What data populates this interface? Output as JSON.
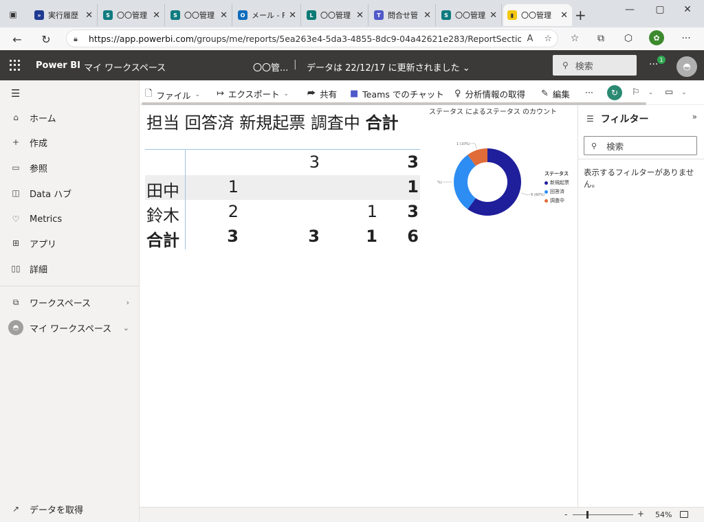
{
  "browser": {
    "tabs": [
      {
        "title": "実行履歴",
        "fav_color": "#1f3a93",
        "fav_glyph": "»"
      },
      {
        "title": "〇〇管理",
        "fav_color": "#0f7b7f",
        "fav_glyph": "S"
      },
      {
        "title": "〇〇管理",
        "fav_color": "#0f7b7f",
        "fav_glyph": "S"
      },
      {
        "title": "メール - F",
        "fav_color": "#0f6cbd",
        "fav_glyph": "O"
      },
      {
        "title": "〇〇管理",
        "fav_color": "#0b7a75",
        "fav_glyph": "L"
      },
      {
        "title": "問合せ管",
        "fav_color": "#5059c9",
        "fav_glyph": "T"
      },
      {
        "title": "〇〇管理",
        "fav_color": "#0f7b7f",
        "fav_glyph": "S"
      },
      {
        "title": "〇〇管理",
        "fav_color": "#f2c811",
        "fav_glyph": "▮"
      }
    ],
    "url_host": "https://app.powerbi.com",
    "url_path": "/groups/me/reports/5ea263e4-5da3-4855-8dc9-04a42621e283/ReportSection",
    "read_aloud": "Aͅ",
    "profile_initial": "✿"
  },
  "header": {
    "brand": "Power BI",
    "workspace": "マイ ワークスペース",
    "report_name": "〇〇管...",
    "separator": "|",
    "refresh_info": "データは 22/12/17 に更新されました",
    "search_placeholder": "検索",
    "notification_count": "1"
  },
  "leftnav": {
    "items": [
      {
        "label": "ホーム",
        "icon": "⌂"
      },
      {
        "label": "作成",
        "icon": "+"
      },
      {
        "label": "参照",
        "icon": "▭"
      },
      {
        "label": "Data ハブ",
        "icon": "◫"
      },
      {
        "label": "Metrics",
        "icon": "♡"
      },
      {
        "label": "アプリ",
        "icon": "⊞"
      },
      {
        "label": "詳細",
        "icon": "▯▯"
      }
    ],
    "workspaces": "ワークスペース",
    "my_workspace": "マイ ワークスペース",
    "get_data": "データを取得"
  },
  "toolbar": {
    "file": "ファイル",
    "export": "エクスポート",
    "share": "共有",
    "teams": "Teams でのチャット",
    "insights": "分析情報の取得",
    "edit": "編集",
    "more": "···"
  },
  "matrix": {
    "headers": [
      "担当",
      "回答済",
      "新規起票",
      "調査中",
      "合計"
    ],
    "rows": [
      {
        "label": "",
        "values": [
          "",
          "3",
          "",
          "3"
        ]
      },
      {
        "label": "田中",
        "values": [
          "1",
          "",
          "",
          "1"
        ]
      },
      {
        "label": "鈴木",
        "values": [
          "2",
          "",
          "1",
          "3"
        ]
      },
      {
        "label": "合計",
        "values": [
          "3",
          "3",
          "1",
          "6"
        ]
      }
    ]
  },
  "chart_data": {
    "type": "pie",
    "title": "ステータス によるステータス のカウント",
    "legend_title": "ステータス",
    "legend_position": "right",
    "categories": [
      "新規起票",
      "回答済",
      "調査中"
    ],
    "values": [
      6,
      3,
      1
    ],
    "labels": [
      "6 (60%)",
      "3 (30%)",
      "1 (10%)"
    ],
    "colors": [
      "#1f1f9b",
      "#2d8df2",
      "#e06c3a"
    ],
    "donut": true
  },
  "filters": {
    "title": "フィルター",
    "search_placeholder": "検索",
    "empty_message": "表示するフィルターがありません。"
  },
  "statusbar": {
    "zoom_minus": "-",
    "zoom_plus": "+",
    "zoom_percent": "54%"
  }
}
